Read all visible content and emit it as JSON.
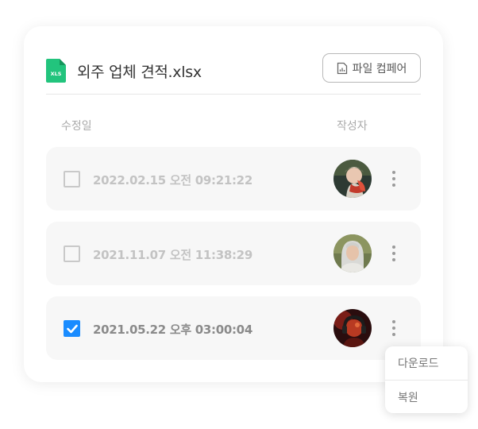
{
  "file": {
    "icon": "xls-file-icon",
    "icon_text": "XLS",
    "icon_color": "#1fc27a",
    "name": "외주 업체 견적.xlsx"
  },
  "toolbar": {
    "compare_label": "파일 컴페어",
    "compare_icon": "chart-document-icon"
  },
  "columns": {
    "date": "수정일",
    "author": "작성자"
  },
  "versions": [
    {
      "date": "2022.02.15 오전 09:21:22",
      "checked": false,
      "avatar": "avatar-elderly-woman-scarf"
    },
    {
      "date": "2021.11.07 오전 11:38:29",
      "checked": false,
      "avatar": "avatar-gray-haired-woman"
    },
    {
      "date": "2021.05.22 오후 03:00:04",
      "checked": true,
      "avatar": "avatar-person-headphones"
    }
  ],
  "context_menu": {
    "items": [
      "다운로드",
      "복원"
    ]
  },
  "colors": {
    "accent": "#1a8cff",
    "row_bg": "#f7f7f7"
  }
}
